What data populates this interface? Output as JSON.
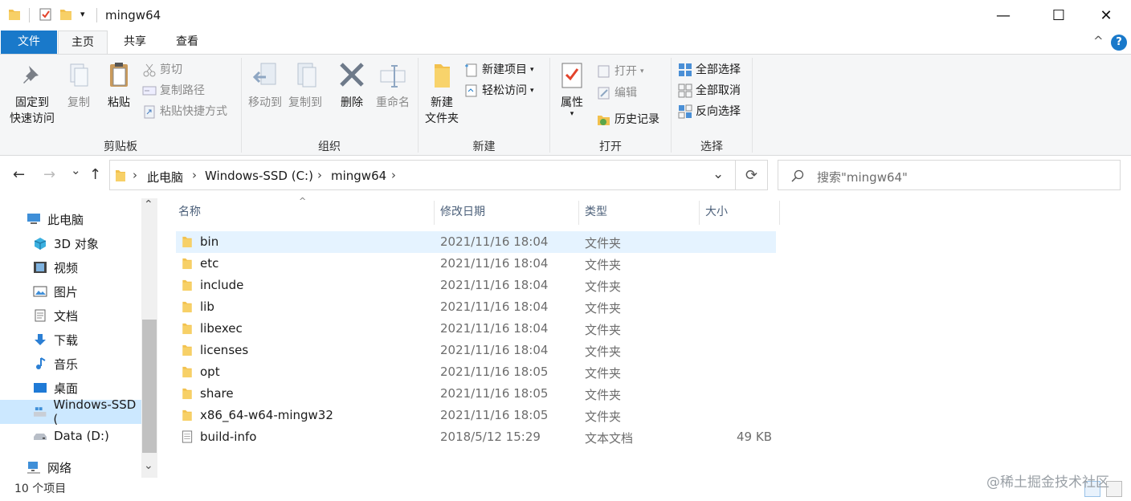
{
  "window": {
    "title": "mingw64",
    "minimize_icon": "—",
    "maximize_icon": "☐",
    "close_icon": "✕",
    "qa_menu_glyph": "▾"
  },
  "tabs": [
    {
      "label": "文件",
      "active": false,
      "file": true
    },
    {
      "label": "主页",
      "active": true,
      "file": false
    },
    {
      "label": "共享",
      "active": false,
      "file": false
    },
    {
      "label": "查看",
      "active": false,
      "file": false
    }
  ],
  "ribbon_controls": {
    "collapse": "^",
    "help": "?"
  },
  "ribbon": {
    "clipboard": {
      "label": "剪贴板",
      "pin_line1": "固定到",
      "pin_line2": "快速访问",
      "copy": "复制",
      "paste": "粘贴",
      "cut": "剪切",
      "copy_path": "复制路径",
      "paste_shortcut": "粘贴快捷方式"
    },
    "organize": {
      "label": "组织",
      "move_to": "移动到",
      "copy_to": "复制到",
      "delete": "删除",
      "rename": "重命名"
    },
    "new": {
      "label": "新建",
      "new_folder_line1": "新建",
      "new_folder_line2": "文件夹",
      "new_item": "新建项目",
      "easy_access": "轻松访问"
    },
    "open": {
      "label": "打开",
      "properties": "属性",
      "open": "打开",
      "edit": "编辑",
      "history": "历史记录"
    },
    "select": {
      "label": "选择",
      "select_all": "全部选择",
      "select_none": "全部取消",
      "invert": "反向选择"
    }
  },
  "nav": {
    "back_glyph": "←",
    "forward_glyph": "→",
    "recent_glyph": "⌄",
    "up_glyph": "↑",
    "refresh_glyph": "⟳",
    "breadcrumb": [
      "此电脑",
      "Windows-SSD (C:)",
      "mingw64"
    ],
    "search_placeholder": "搜索\"mingw64\""
  },
  "scroll_glyphs": {
    "up": "⌃",
    "down": "⌄"
  },
  "sidebar": [
    {
      "label": "此电脑",
      "icon": "pc-icon",
      "indent": 0
    },
    {
      "label": "3D 对象",
      "icon": "3d-objects-icon",
      "indent": 1
    },
    {
      "label": "视频",
      "icon": "video-icon",
      "indent": 1
    },
    {
      "label": "图片",
      "icon": "pictures-icon",
      "indent": 1
    },
    {
      "label": "文档",
      "icon": "documents-icon",
      "indent": 1
    },
    {
      "label": "下载",
      "icon": "downloads-icon",
      "indent": 1
    },
    {
      "label": "音乐",
      "icon": "music-icon",
      "indent": 1
    },
    {
      "label": "桌面",
      "icon": "desktop-icon",
      "indent": 1
    },
    {
      "label": "Windows-SSD (",
      "icon": "drive-c-icon",
      "indent": 1,
      "selected": true
    },
    {
      "label": "Data (D:)",
      "icon": "drive-d-icon",
      "indent": 1
    },
    {
      "label": "网络",
      "icon": "network-icon",
      "indent": 0
    }
  ],
  "columns": {
    "name": "名称",
    "modified": "修改日期",
    "type": "类型",
    "size": "大小",
    "sort_glyph": "^"
  },
  "files": [
    {
      "name": "bin",
      "modified": "2021/11/16 18:04",
      "type": "文件夹",
      "size": "",
      "kind": "folder",
      "selected": true
    },
    {
      "name": "etc",
      "modified": "2021/11/16 18:04",
      "type": "文件夹",
      "size": "",
      "kind": "folder"
    },
    {
      "name": "include",
      "modified": "2021/11/16 18:04",
      "type": "文件夹",
      "size": "",
      "kind": "folder"
    },
    {
      "name": "lib",
      "modified": "2021/11/16 18:04",
      "type": "文件夹",
      "size": "",
      "kind": "folder"
    },
    {
      "name": "libexec",
      "modified": "2021/11/16 18:04",
      "type": "文件夹",
      "size": "",
      "kind": "folder"
    },
    {
      "name": "licenses",
      "modified": "2021/11/16 18:04",
      "type": "文件夹",
      "size": "",
      "kind": "folder"
    },
    {
      "name": "opt",
      "modified": "2021/11/16 18:05",
      "type": "文件夹",
      "size": "",
      "kind": "folder"
    },
    {
      "name": "share",
      "modified": "2021/11/16 18:05",
      "type": "文件夹",
      "size": "",
      "kind": "folder"
    },
    {
      "name": "x86_64-w64-mingw32",
      "modified": "2021/11/16 18:05",
      "type": "文件夹",
      "size": "",
      "kind": "folder"
    },
    {
      "name": "build-info",
      "modified": "2018/5/12 15:29",
      "type": "文本文档",
      "size": "49 KB",
      "kind": "text"
    }
  ],
  "status": {
    "item_count": "10 个项目"
  },
  "watermark": "@稀土掘金技术社区",
  "colors": {
    "file_tab": "#1979ca",
    "selection": "#cce8ff",
    "row_selected": "#e5f3ff",
    "folder": "#f2c14e"
  }
}
